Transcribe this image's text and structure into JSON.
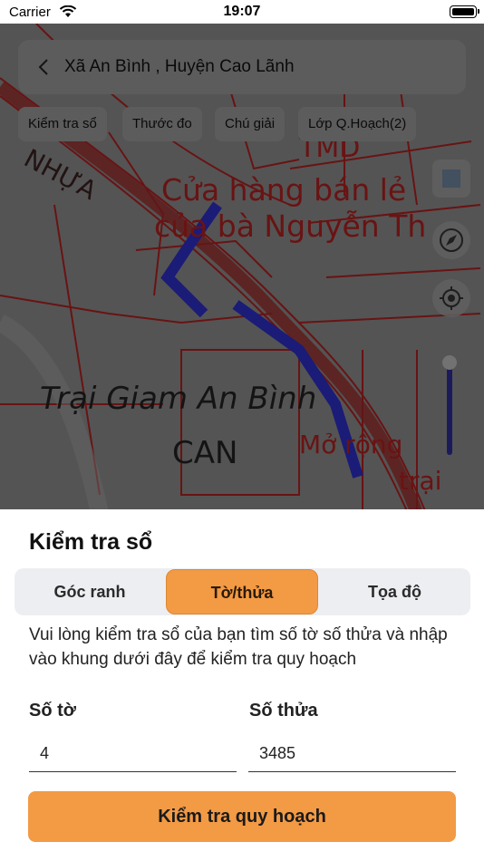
{
  "status_bar": {
    "carrier": "Carrier",
    "time": "19:07"
  },
  "map": {
    "search_text": "Xã An Bình , Huyện Cao Lãnh",
    "chips": [
      "Kiểm tra sổ",
      "Thước đo",
      "Chú giải",
      "Lớp Q.Hoạch(2)"
    ],
    "labels": {
      "shop_line1": "Cửa hàng bán lẻ",
      "shop_line2": "của bà Nguyễn Th",
      "prison": "Trại Giam An Bình",
      "can": "CAN",
      "nhua": "NHỰA",
      "thd": "TMD",
      "mo_rong": "Mở rộng",
      "tran": "trại"
    },
    "colors": {
      "road_red": "#b02020",
      "route_blue": "#2d2dc8"
    }
  },
  "sheet": {
    "title": "Kiểm tra sổ",
    "tabs": [
      "Góc ranh",
      "Tờ/thửa",
      "Tọa độ"
    ],
    "active_tab": "Tờ/thửa",
    "instruction": "Vui lòng kiểm tra sổ của bạn tìm số tờ số thửa và nhập vào khung dưới đây để kiểm tra quy hoạch",
    "fields": {
      "so_to": {
        "label": "Số tờ",
        "value": "4"
      },
      "so_thua": {
        "label": "Số thửa",
        "value": "3485"
      }
    },
    "submit_label": "Kiểm tra quy hoạch",
    "colors": {
      "accent": "#f39a45"
    }
  }
}
